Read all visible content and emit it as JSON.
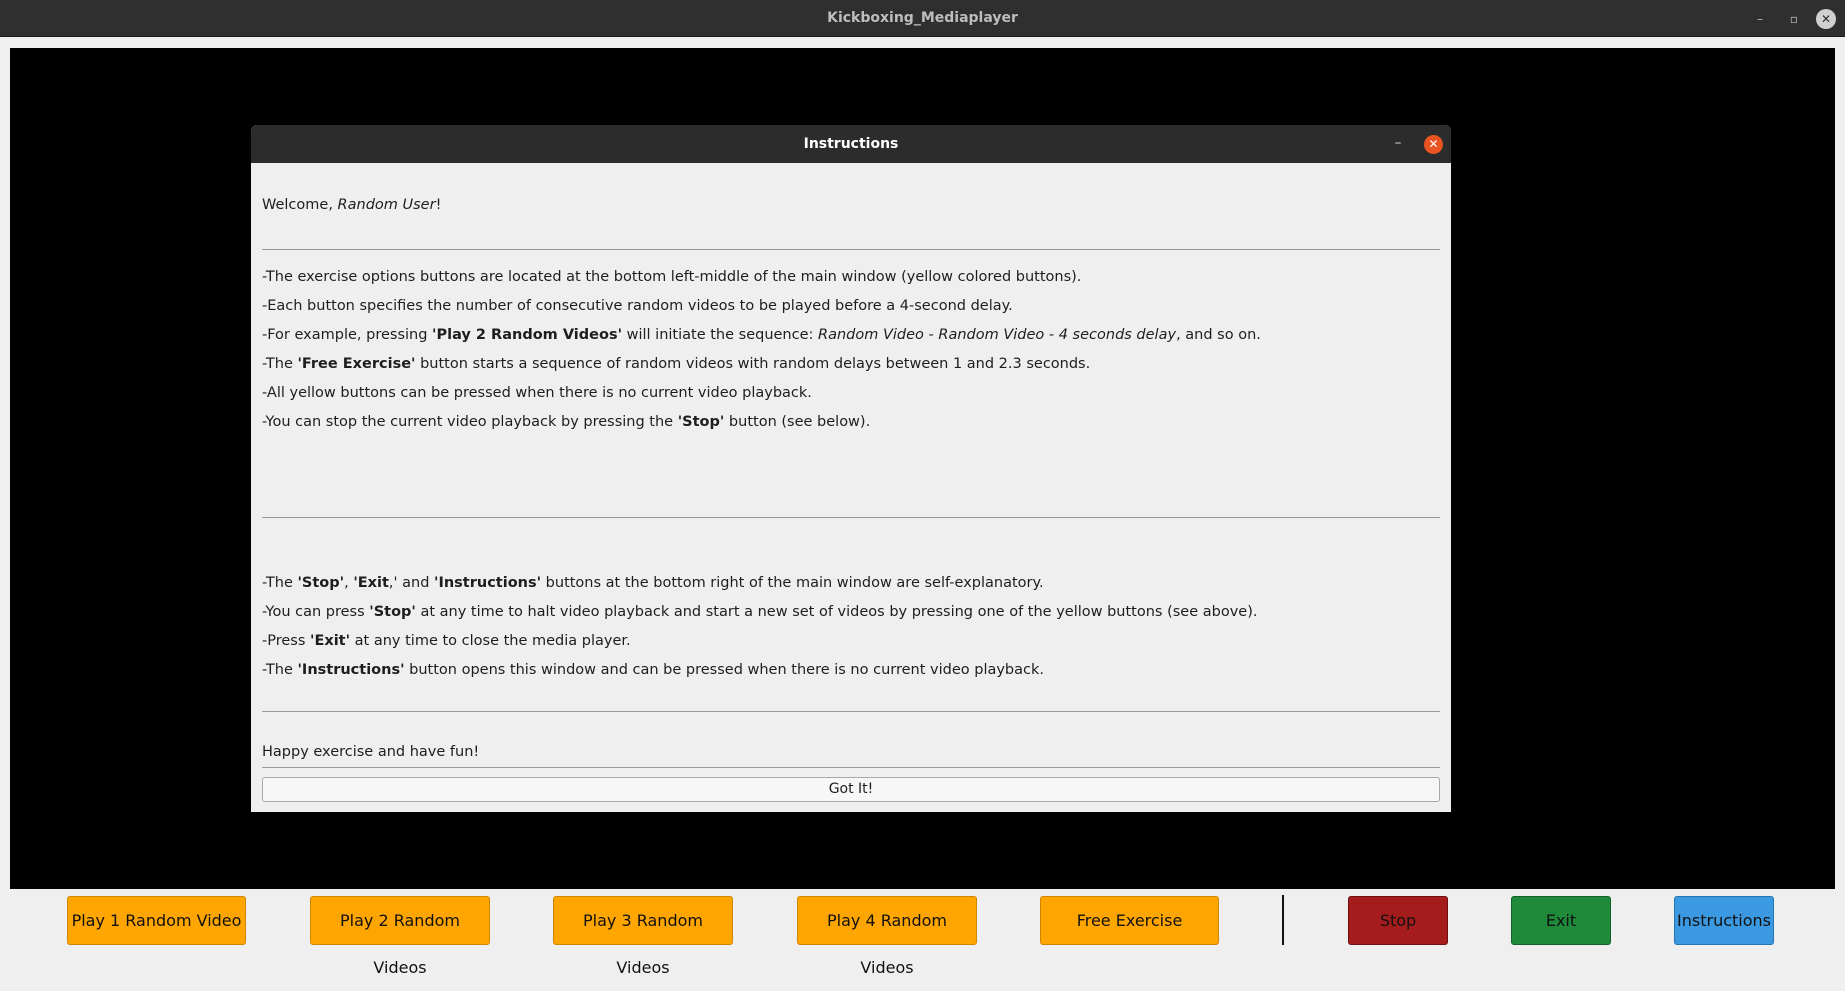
{
  "window": {
    "title": "Kickboxing_Mediaplayer",
    "controls": {
      "minimize": "–",
      "maximize": "▫",
      "close": "✕"
    }
  },
  "dialog": {
    "title": "Instructions",
    "minimize": "–",
    "close": "✕",
    "welcome": {
      "prefix": "Welcome, ",
      "user": "Random User",
      "suffix": "!"
    },
    "section1": [
      [
        {
          "t": "-The exercise options buttons are located at the bottom left-middle of the main window (yellow colored buttons)."
        }
      ],
      [
        {
          "t": "-Each button specifies the number of consecutive random videos to be played before a 4-second delay."
        }
      ],
      [
        {
          "t": "-For example, pressing "
        },
        {
          "t": "'Play 2 Random Videos'",
          "s": "b"
        },
        {
          "t": " will initiate the sequence: "
        },
        {
          "t": "Random Video - Random Video - 4 seconds delay",
          "s": "i"
        },
        {
          "t": ", and so on."
        }
      ],
      [
        {
          "t": "-The "
        },
        {
          "t": "'Free Exercise'",
          "s": "b"
        },
        {
          "t": " button starts a sequence of random videos with random delays between 1 and 2.3 seconds."
        }
      ],
      [
        {
          "t": "-All yellow buttons can be pressed when there is no current video playback."
        }
      ],
      [
        {
          "t": "-You can stop the current video playback by pressing the "
        },
        {
          "t": "'Stop'",
          "s": "b"
        },
        {
          "t": " button (see below)."
        }
      ]
    ],
    "section2": [
      [
        {
          "t": "-The "
        },
        {
          "t": "'Stop'",
          "s": "b"
        },
        {
          "t": ", "
        },
        {
          "t": "'Exit",
          "s": "b"
        },
        {
          "t": ",' and "
        },
        {
          "t": "'Instructions'",
          "s": "b"
        },
        {
          "t": " buttons at the bottom right of the main window are self-explanatory."
        }
      ],
      [
        {
          "t": "-You can press "
        },
        {
          "t": "'Stop'",
          "s": "b"
        },
        {
          "t": " at any time to halt video playback and start a new set of videos by pressing one of the yellow buttons (see above)."
        }
      ],
      [
        {
          "t": "-Press "
        },
        {
          "t": "'Exit'",
          "s": "b"
        },
        {
          "t": " at any time to close the media player."
        }
      ],
      [
        {
          "t": "-The "
        },
        {
          "t": "'Instructions'",
          "s": "b"
        },
        {
          "t": " button opens this window and can be pressed when there is no current video playback."
        }
      ]
    ],
    "closing": "Happy exercise and have fun!",
    "ok_label": "Got It!"
  },
  "toolbar": {
    "play1": "Play 1 Random Video",
    "play2": "Play 2 Random Videos",
    "play3": "Play 3 Random Videos",
    "play4": "Play 4 Random Videos",
    "free": "Free Exercise",
    "stop": "Stop",
    "exit": "Exit",
    "instructions": "Instructions"
  },
  "colors": {
    "exercise_buttons": "#ffa500",
    "stop": "#a51c1c",
    "exit": "#1e8a3a",
    "instructions": "#3a99e0",
    "dialog_close": "#e95420"
  }
}
